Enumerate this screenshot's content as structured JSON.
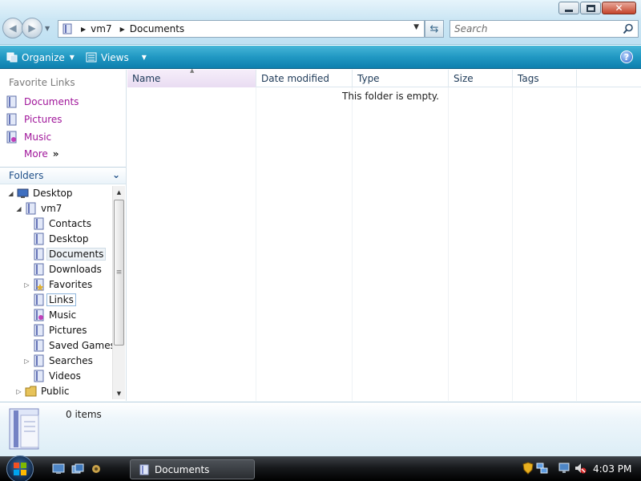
{
  "window": {
    "controls": {
      "minimize": "minimize-icon",
      "maximize": "maximize-icon",
      "close": "close-icon"
    }
  },
  "address": {
    "breadcrumb": [
      "vm7",
      "Documents"
    ]
  },
  "search": {
    "placeholder": "Search"
  },
  "toolbar": {
    "organize_label": "Organize",
    "views_label": "Views",
    "help_label": "?"
  },
  "nav": {
    "favorites_header": "Favorite Links",
    "favorites": [
      {
        "label": "Documents",
        "icon": "documents-icon"
      },
      {
        "label": "Pictures",
        "icon": "pictures-icon"
      },
      {
        "label": "Music",
        "icon": "music-icon"
      }
    ],
    "more_label": "More",
    "more_chevron": "»",
    "folders_header": "Folders",
    "tree": [
      {
        "label": "Desktop",
        "level": 0,
        "expander": "◢",
        "icon": "desktop-icon"
      },
      {
        "label": "vm7",
        "level": 1,
        "expander": "◢",
        "icon": "user-folder-icon"
      },
      {
        "label": "Contacts",
        "level": 2,
        "expander": "",
        "icon": "contacts-icon"
      },
      {
        "label": "Desktop",
        "level": 2,
        "expander": "",
        "icon": "folder-icon"
      },
      {
        "label": "Documents",
        "level": 2,
        "expander": "",
        "icon": "folder-icon",
        "state": "selected"
      },
      {
        "label": "Downloads",
        "level": 2,
        "expander": "",
        "icon": "folder-icon"
      },
      {
        "label": "Favorites",
        "level": 2,
        "expander": "▷",
        "icon": "favorites-icon"
      },
      {
        "label": "Links",
        "level": 2,
        "expander": "",
        "icon": "folder-icon",
        "state": "hover"
      },
      {
        "label": "Music",
        "level": 2,
        "expander": "",
        "icon": "music-icon"
      },
      {
        "label": "Pictures",
        "level": 2,
        "expander": "",
        "icon": "pictures-icon"
      },
      {
        "label": "Saved Games",
        "level": 2,
        "expander": "",
        "icon": "folder-icon"
      },
      {
        "label": "Searches",
        "level": 2,
        "expander": "▷",
        "icon": "searches-icon"
      },
      {
        "label": "Videos",
        "level": 2,
        "expander": "",
        "icon": "videos-icon"
      },
      {
        "label": "Public",
        "level": 1,
        "expander": "▷",
        "icon": "public-folder-icon"
      }
    ]
  },
  "filelist": {
    "columns": [
      "Name",
      "Date modified",
      "Type",
      "Size",
      "Tags"
    ],
    "sorted_column": "Name",
    "empty_message": "This folder is empty."
  },
  "details": {
    "item_count": "0 items"
  },
  "taskbar": {
    "task_label": "Documents",
    "clock": "4:03 PM"
  },
  "colors": {
    "command_bar": "#2198c3",
    "favorite_link": "#a0159a",
    "folders_header": "#1f4f88"
  }
}
